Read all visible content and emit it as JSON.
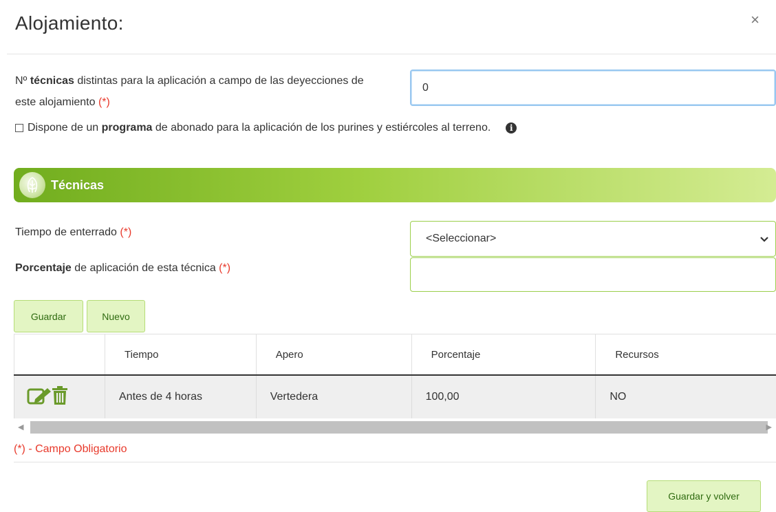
{
  "modal": {
    "title": "Alojamiento:",
    "close_label": "×"
  },
  "tecnicas_field": {
    "label_prefix": "Nº ",
    "label_bold": "técnicas",
    "label_rest": " distintas para la aplicación a campo de las deyecciones de este alojamiento ",
    "required_mark": "(*)",
    "value": "0"
  },
  "programa_checkbox": {
    "checked": false,
    "label_prefix": "Dispone de un ",
    "label_bold": "programa",
    "label_rest": " de abonado para la aplicación de los purines y estiércoles al terreno.",
    "info_icon": "i"
  },
  "section": {
    "title": "Técnicas"
  },
  "tiempo_field": {
    "label": "Tiempo de enterrado ",
    "required_mark": "(*)",
    "selected": "<Seleccionar>"
  },
  "porcentaje_field": {
    "label_bold": "Porcentaje",
    "label_rest": " de aplicación de esta técnica ",
    "required_mark": "(*)",
    "value": ""
  },
  "buttons": {
    "guardar": "Guardar",
    "nuevo": "Nuevo",
    "guardar_volver": "Guardar y volver"
  },
  "table": {
    "columns": [
      "",
      "Tiempo",
      "Apero",
      "Porcentaje",
      "Recursos"
    ],
    "rows": [
      {
        "tiempo": "Antes de 4 horas",
        "apero": "Vertedera",
        "porcentaje": "100,00",
        "recursos": "NO"
      }
    ]
  },
  "footnote": "(*) - Campo Obligatorio",
  "colors": {
    "accent_green": "#71ad1e",
    "light_green": "#e3f5c3",
    "required_red": "#e8392b",
    "icon_green": "#6a9a2a"
  }
}
